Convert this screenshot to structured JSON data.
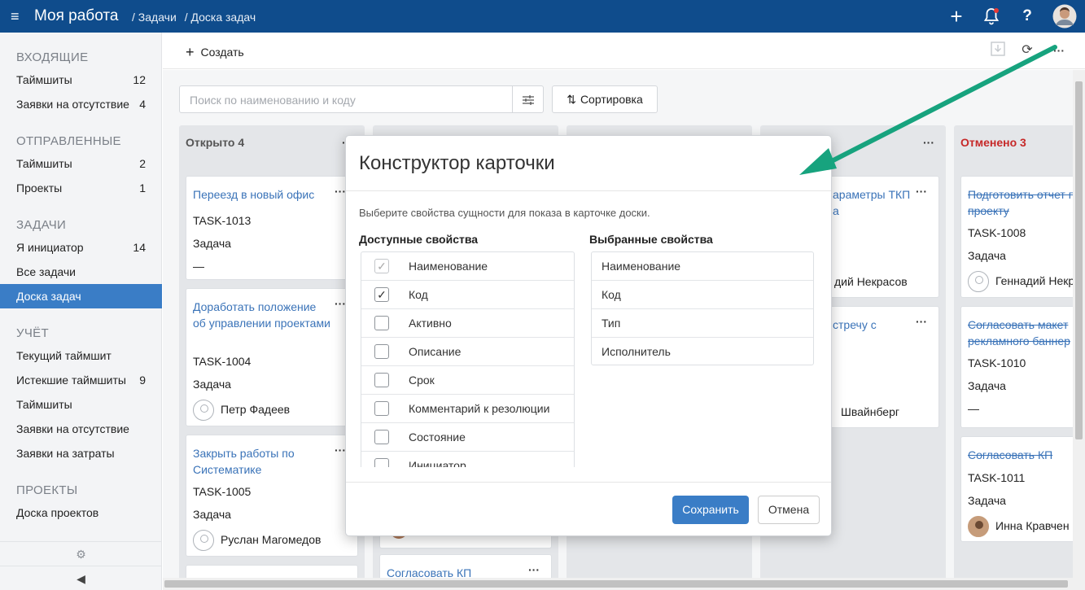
{
  "topbar": {
    "app_title": "Моя работа",
    "breadcrumb": [
      "/ Задачи",
      "/ Доска задач"
    ]
  },
  "sidebar": {
    "inbox": {
      "title": "ВХОДЯЩИЕ",
      "items": [
        {
          "label": "Таймшиты",
          "count": "12"
        },
        {
          "label": "Заявки на отсутствие",
          "count": "4"
        }
      ]
    },
    "sent": {
      "title": "ОТПРАВЛЕННЫЕ",
      "items": [
        {
          "label": "Таймшиты",
          "count": "2"
        },
        {
          "label": "Проекты",
          "count": "1"
        }
      ]
    },
    "tasks": {
      "title": "ЗАДАЧИ",
      "items": [
        {
          "label": "Я инициатор",
          "count": "14"
        },
        {
          "label": "Все задачи",
          "count": ""
        },
        {
          "label": "Доска задач",
          "count": ""
        }
      ]
    },
    "account": {
      "title": "УЧЁТ",
      "items": [
        {
          "label": "Текущий таймшит",
          "count": ""
        },
        {
          "label": "Истекшие таймшиты",
          "count": "9"
        },
        {
          "label": "Таймшиты",
          "count": ""
        },
        {
          "label": "Заявки на отсутствие",
          "count": ""
        },
        {
          "label": "Заявки на затраты",
          "count": ""
        }
      ]
    },
    "projects": {
      "title": "ПРОЕКТЫ",
      "items": [
        {
          "label": "Доска проектов",
          "count": ""
        }
      ]
    }
  },
  "toolbar": {
    "create_label": "Создать"
  },
  "board": {
    "search_placeholder": "Поиск по наименованию и коду",
    "sort_label": "Сортировка",
    "columns": [
      {
        "title": "Открыто 4",
        "cards": [
          {
            "title": "Переезд в новый офис",
            "code": "TASK-1013",
            "type": "Задача",
            "assignee": "—"
          },
          {
            "title": "Доработать положение об управлении проектами",
            "code": "TASK-1004",
            "type": "Задача",
            "assignee": "Петр Фадеев"
          },
          {
            "title": "Закрыть работы по Систематике",
            "code": "TASK-1005",
            "type": "Задача",
            "assignee": "Руслан Магомедов"
          }
        ]
      },
      {
        "title": "",
        "cards": [
          {
            "title": "Согласовать КП"
          }
        ]
      },
      {
        "title": "",
        "cards": []
      },
      {
        "title": "",
        "cards": [
          {
            "title": "араметры ТКП а",
            "assignee": "дий Некрасов"
          },
          {
            "title": "стречу с",
            "assignee": "Швайнберг"
          }
        ]
      },
      {
        "title": "Отменено 3",
        "title_color": "#c62828",
        "cards": [
          {
            "title": "Подготовить отчет п проекту",
            "code": "TASK-1008",
            "type": "Задача",
            "assignee": "Геннадий Некр"
          },
          {
            "title": "Согласовать макет рекламного баннер",
            "code": "TASK-1010",
            "type": "Задача",
            "assignee": "—"
          },
          {
            "title": "Согласовать КП",
            "code": "TASK-1011",
            "type": "Задача",
            "assignee": "Инна Кравчен"
          }
        ]
      }
    ]
  },
  "modal": {
    "title": "Конструктор карточки",
    "hint": "Выберите свойства сущности для показа в карточке доски.",
    "available_title": "Доступные свойства",
    "selected_title": "Выбранные свойства",
    "available": [
      {
        "label": "Наименование",
        "checked": true,
        "disabled": true
      },
      {
        "label": "Код",
        "checked": true,
        "disabled": false
      },
      {
        "label": "Активно",
        "checked": false,
        "disabled": false
      },
      {
        "label": "Описание",
        "checked": false,
        "disabled": false
      },
      {
        "label": "Срок",
        "checked": false,
        "disabled": false
      },
      {
        "label": "Комментарий к резолюции",
        "checked": false,
        "disabled": false
      },
      {
        "label": "Состояние",
        "checked": false,
        "disabled": false
      },
      {
        "label": "Инициатор",
        "checked": false,
        "disabled": false
      }
    ],
    "selected": [
      "Наименование",
      "Код",
      "Тип",
      "Исполнитель"
    ],
    "save_label": "Сохранить",
    "cancel_label": "Отмена"
  },
  "colors": {
    "topbar": "#0f4c8c",
    "accent": "#3a7dc6",
    "cancelled": "#c62828",
    "arrow": "#17a37e"
  }
}
